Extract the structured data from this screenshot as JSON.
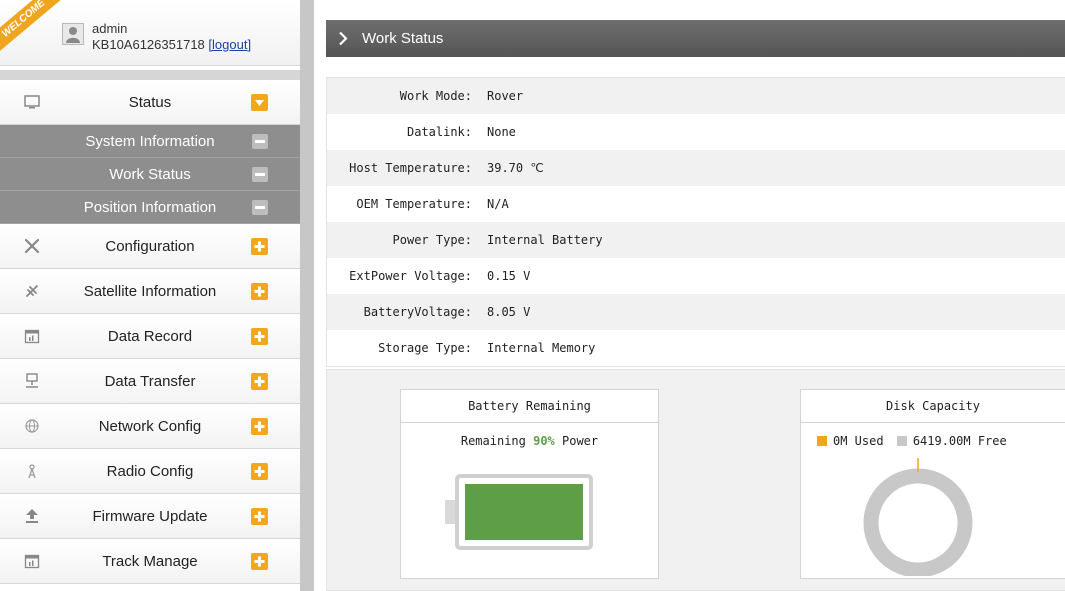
{
  "user": {
    "welcome": "WELCOME",
    "name": "admin",
    "serial": "KB10A6126351718",
    "logout": "[logout]"
  },
  "sidebar": {
    "status": {
      "label": "Status",
      "icon": "monitor-icon",
      "expanded": true
    },
    "status_subitems": [
      {
        "label": "System Information"
      },
      {
        "label": "Work Status"
      },
      {
        "label": "Position Information"
      }
    ],
    "items": [
      {
        "label": "Configuration",
        "icon": "wrench-icon"
      },
      {
        "label": "Satellite Information",
        "icon": "satellite-icon"
      },
      {
        "label": "Data Record",
        "icon": "calendar-icon"
      },
      {
        "label": "Data Transfer",
        "icon": "network-icon"
      },
      {
        "label": "Network Config",
        "icon": "globe-icon"
      },
      {
        "label": "Radio Config",
        "icon": "antenna-icon"
      },
      {
        "label": "Firmware Update",
        "icon": "upload-icon"
      },
      {
        "label": "Track Manage",
        "icon": "calendar-icon"
      }
    ]
  },
  "main": {
    "title": "Work Status",
    "rows": [
      {
        "label": "Work Mode:",
        "value": "Rover"
      },
      {
        "label": "Datalink:",
        "value": "None"
      },
      {
        "label": "Host Temperature:",
        "value": "39.70 ℃"
      },
      {
        "label": "OEM Temperature:",
        "value": "N/A"
      },
      {
        "label": "Power Type:",
        "value": "Internal Battery"
      },
      {
        "label": "ExtPower Voltage:",
        "value": "0.15 V"
      },
      {
        "label": "BatteryVoltage:",
        "value": "8.05 V"
      },
      {
        "label": "Storage Type:",
        "value": "Internal Memory"
      }
    ],
    "battery": {
      "title": "Battery Remaining",
      "prefix": "Remaining ",
      "percent_text": "90%",
      "suffix": " Power",
      "percent": 90
    },
    "disk": {
      "title": "Disk Capacity",
      "used_label": "0M Used",
      "free_label": "6419.00M Free",
      "used_mb": 0,
      "free_mb": 6419.0
    }
  },
  "colors": {
    "accent": "#f4a71d",
    "battery_fill": "#5d9e47",
    "disk_used": "#f0a521",
    "disk_free": "#c8c8c8",
    "title_bar": "#5f5f5f"
  }
}
